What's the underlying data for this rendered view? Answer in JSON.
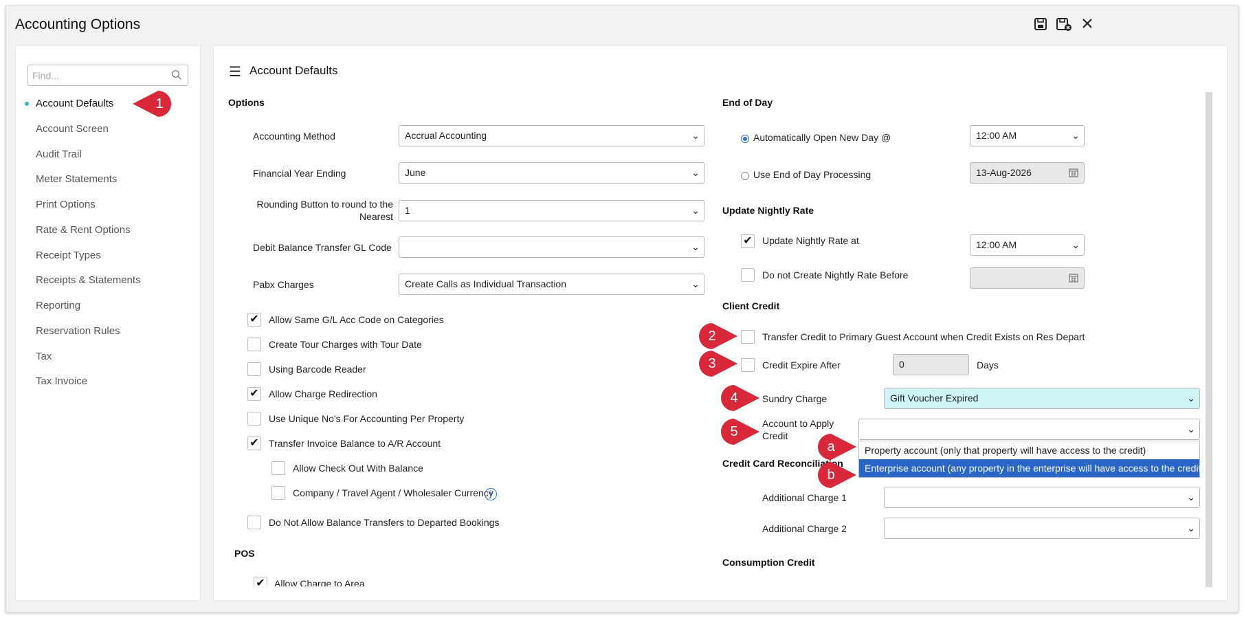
{
  "window": {
    "title": "Accounting Options"
  },
  "header_icons": [
    "save-icon",
    "save-and-close-icon",
    "close-icon"
  ],
  "search": {
    "placeholder": "Find..."
  },
  "sidebar": {
    "items": [
      {
        "label": "Account Defaults",
        "active": true
      },
      {
        "label": "Account Screen"
      },
      {
        "label": "Audit Trail"
      },
      {
        "label": "Meter Statements"
      },
      {
        "label": "Print Options"
      },
      {
        "label": "Rate & Rent Options"
      },
      {
        "label": "Receipt Types"
      },
      {
        "label": "Receipts & Statements"
      },
      {
        "label": "Reporting"
      },
      {
        "label": "Reservation Rules"
      },
      {
        "label": "Tax"
      },
      {
        "label": "Tax Invoice"
      }
    ]
  },
  "main": {
    "title": "Account Defaults",
    "options": {
      "heading": "Options",
      "accounting_method": {
        "label": "Accounting Method",
        "value": "Accrual Accounting"
      },
      "financial_year": {
        "label": "Financial Year Ending",
        "value": "June"
      },
      "rounding": {
        "label_line1": "Rounding Button to round to the",
        "label_line2": "Nearest",
        "value": "1"
      },
      "debit_gl": {
        "label": "Debit Balance Transfer GL Code",
        "value": ""
      },
      "pabx": {
        "label": "Pabx Charges",
        "value": "Create Calls as Individual Transaction"
      },
      "checkboxes": [
        {
          "label": "Allow Same G/L Acc Code on Categories",
          "checked": true
        },
        {
          "label": "Create Tour Charges with Tour Date",
          "checked": false
        },
        {
          "label": "Using Barcode Reader",
          "checked": false
        },
        {
          "label": "Allow Charge Redirection",
          "checked": true
        },
        {
          "label": "Use Unique No's For Accounting Per Property",
          "checked": false
        },
        {
          "label": "Transfer Invoice Balance to A/R Account",
          "checked": true
        },
        {
          "label": "Allow Check Out With Balance",
          "checked": false
        },
        {
          "label": "Company / Travel Agent / Wholesaler Currency",
          "checked": false
        },
        {
          "label": "Do Not Allow Balance Transfers to Departed Bookings",
          "checked": false
        }
      ]
    },
    "pos": {
      "heading": "POS",
      "allow_charge": {
        "label": "Allow Charge to Area",
        "checked": true
      }
    },
    "end_of_day": {
      "heading": "End of Day",
      "auto_open": {
        "label": "Automatically Open New Day @",
        "value": "12:00 AM",
        "selected": true
      },
      "use_eod": {
        "label": "Use End of Day Processing",
        "value": "13-Aug-2026",
        "selected": false
      }
    },
    "nightly": {
      "heading": "Update Nightly Rate",
      "update_at": {
        "label": "Update Nightly Rate at",
        "value": "12:00 AM",
        "checked": true
      },
      "not_before": {
        "label": "Do not Create Nightly Rate Before",
        "value": "",
        "checked": false
      }
    },
    "client_credit": {
      "heading": "Client Credit",
      "transfer": {
        "label": "Transfer Credit to Primary Guest Account when Credit Exists on Res Depart",
        "checked": false
      },
      "expire": {
        "label": "Credit Expire After",
        "value": "0",
        "unit": "Days",
        "checked": false
      },
      "sundry": {
        "label": "Sundry Charge",
        "value": "Gift Voucher Expired"
      },
      "apply": {
        "label_line1": "Account to Apply",
        "label_line2": "Credit",
        "value": ""
      },
      "dropdown_options": [
        {
          "label": "Property account (only that property will have access to the credit)",
          "selected": false
        },
        {
          "label": "Enterprise account (any property in the enterprise will have access to the credit)",
          "selected": true
        }
      ]
    },
    "cc_recon": {
      "heading": "Credit Card Reconciliation",
      "charge1": {
        "label": "Additional Charge 1",
        "value": ""
      },
      "charge2": {
        "label": "Additional Charge 2",
        "value": ""
      }
    },
    "consumption": {
      "heading": "Consumption Credit"
    }
  },
  "annotations": [
    "1",
    "2",
    "3",
    "4",
    "5",
    "a",
    "b"
  ],
  "colors": {
    "annotation": "#d8283a",
    "accent": "#3bb3c3",
    "highlight": "#cff4f7",
    "selection": "#2a66c7"
  }
}
